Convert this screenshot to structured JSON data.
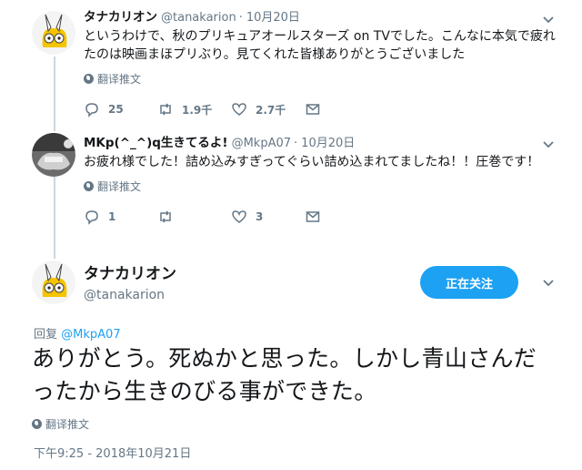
{
  "thread": [
    {
      "name": "タナカリオン",
      "handle": "@tanakarion",
      "sep": "·",
      "time": "10月20日",
      "text": "というわけで、秋のプリキュアオールスターズ on TVでした。こんなに本気で疲れたのは映画まほプリぶり。見てくれた皆様ありがとうございました",
      "translate": "翻译推文",
      "replies": "25",
      "retweets": "1.9千",
      "likes": "2.7千"
    },
    {
      "name": "MKp(^_^)q生きてるよ!",
      "handle": "@MkpA07",
      "sep": "·",
      "time": "10月20日",
      "text": "お疲れ様でした！詰め込みすぎってぐらい詰め込まれてましたね！！圧巻です！",
      "translate": "翻译推文",
      "replies": "1",
      "retweets": "",
      "likes": "3"
    }
  ],
  "main": {
    "name": "タナカリオン",
    "handle": "@tanakarion",
    "follow_label": "正在关注",
    "reply_prefix": "回复",
    "reply_mention": "@MkpA07",
    "text": "ありがとう。死ぬかと思った。しかし青山さんだったから生きのびる事ができた。",
    "translate": "翻译推文",
    "timestamp": "下午9:25 - 2018年10月21日"
  },
  "icons": {
    "reply": "reply-icon",
    "retweet": "retweet-icon",
    "like": "heart-icon",
    "dm": "envelope-icon",
    "translate": "globe-icon",
    "more": "chevron-down-icon"
  },
  "colors": {
    "accent": "#1da1f2",
    "muted": "#657786",
    "thread_line": "#ccd6dd"
  }
}
